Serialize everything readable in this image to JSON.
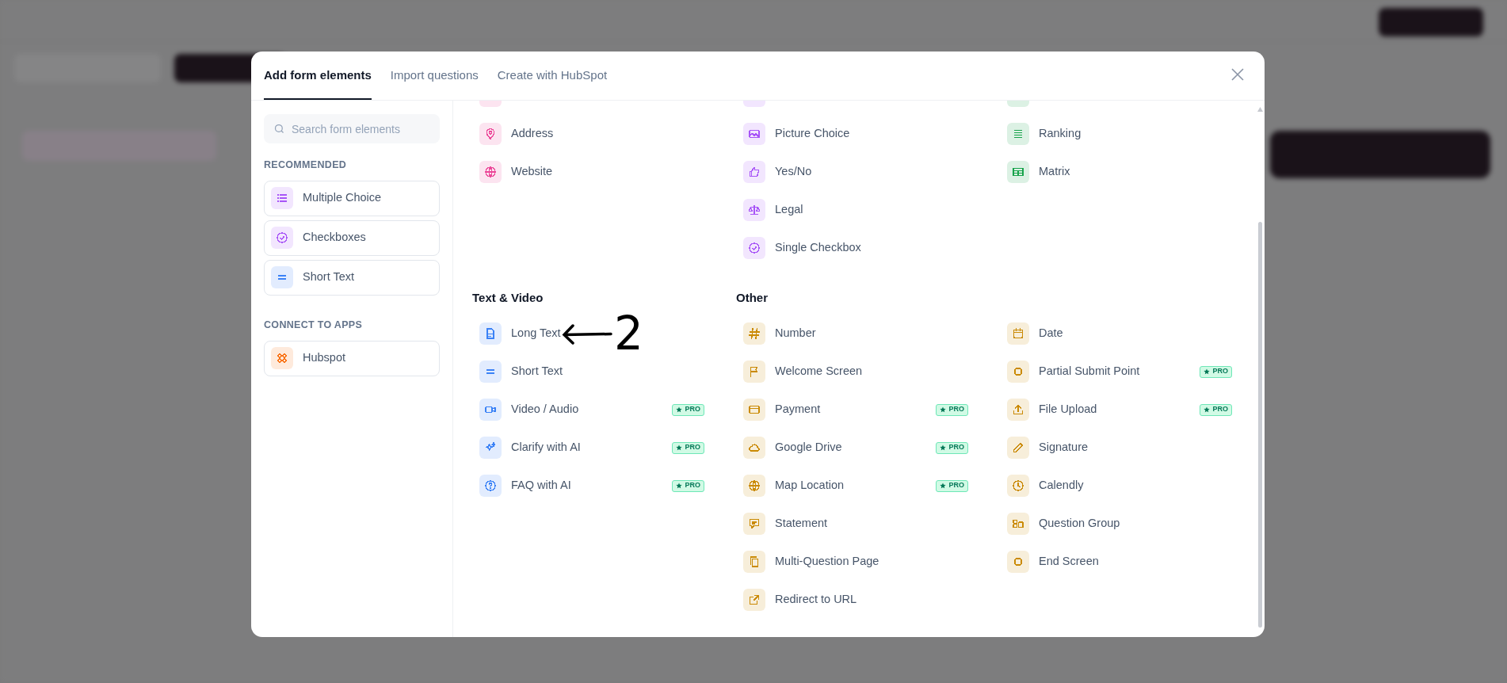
{
  "tabs": [
    {
      "label": "Add form elements",
      "selected": true
    },
    {
      "label": "Import questions",
      "selected": false
    },
    {
      "label": "Create with HubSpot",
      "selected": false
    }
  ],
  "sidebar": {
    "search": {
      "placeholder": "Search form elements"
    },
    "groups": [
      {
        "title": "RECOMMENDED",
        "items": [
          {
            "label": "Multiple Choice",
            "color": "#a855f7"
          },
          {
            "label": "Checkboxes",
            "color": "#a855f7"
          },
          {
            "label": "Short Text",
            "color": "#3b82f6"
          }
        ]
      },
      {
        "title": "CONNECT TO APPS",
        "items": [
          {
            "label": "Hubspot",
            "color": "#f97316"
          }
        ]
      }
    ]
  },
  "sections": [
    {
      "columns": [
        {
          "color": "#ec4899",
          "items": [
            {
              "label": "Address"
            },
            {
              "label": "Website"
            }
          ]
        },
        {
          "color": "#a855f7",
          "items": [
            {
              "label": "Picture Choice"
            },
            {
              "label": "Yes/No"
            },
            {
              "label": "Legal"
            },
            {
              "label": "Single Checkbox"
            }
          ]
        },
        {
          "color": "#16a34a",
          "items": [
            {
              "label": "Ranking"
            },
            {
              "label": "Matrix"
            }
          ]
        }
      ]
    },
    {
      "title": "Text & Video",
      "columns": [
        {
          "color": "#3b82f6",
          "items": [
            {
              "label": "Long Text"
            },
            {
              "label": "Short Text"
            },
            {
              "label": "Video / Audio",
              "badge": "PRO"
            },
            {
              "label": "Clarify with AI",
              "badge": "PRO"
            },
            {
              "label": "FAQ with AI",
              "badge": "PRO"
            }
          ]
        }
      ]
    },
    {
      "title": "Other",
      "columns": [
        {
          "color": "#ca8a04",
          "items": [
            {
              "label": "Number"
            },
            {
              "label": "Welcome Screen"
            },
            {
              "label": "Payment",
              "badge": "PRO"
            },
            {
              "label": "Google Drive",
              "badge": "PRO"
            },
            {
              "label": "Map Location",
              "badge": "PRO"
            },
            {
              "label": "Statement"
            },
            {
              "label": "Multi-Question Page"
            },
            {
              "label": "Redirect to URL"
            }
          ]
        },
        {
          "color": "#ca8a04",
          "items": [
            {
              "label": "Date"
            },
            {
              "label": "Partial Submit Point",
              "badge": "PRO"
            },
            {
              "label": "File Upload",
              "badge": "PRO"
            },
            {
              "label": "Signature"
            },
            {
              "label": "Calendly"
            },
            {
              "label": "Question Group"
            },
            {
              "label": "End Screen"
            }
          ]
        }
      ]
    }
  ],
  "annotation": {
    "label": "2"
  }
}
